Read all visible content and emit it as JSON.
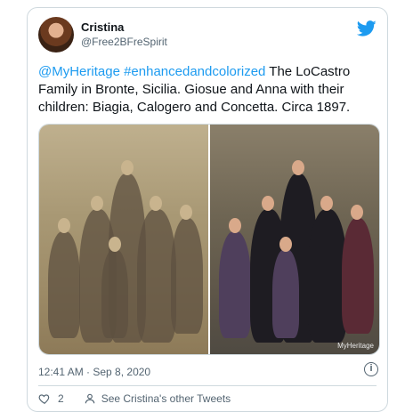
{
  "user": {
    "name": "Cristina",
    "handle": "@Free2BFreSpirit"
  },
  "tweet": {
    "mention": "@MyHeritage",
    "hashtag": "#enhancedandcolorized",
    "body": " The LoCastro Family in Bronte, Sicilia. Giosue and Anna with their children: Biagia, Calogero and Concetta. Circa 1897."
  },
  "media": {
    "watermark": "MyHeritage"
  },
  "meta": {
    "timestamp": "12:41 AM · Sep 8, 2020"
  },
  "actions": {
    "likes": "2",
    "other_tweets": "See Cristina's other Tweets"
  },
  "colors": {
    "twitter_blue": "#1d9bf0",
    "text": "#0f1419",
    "muted": "#536471"
  },
  "icons": [
    "twitter-bird-icon",
    "info-icon",
    "heart-icon",
    "person-icon"
  ]
}
